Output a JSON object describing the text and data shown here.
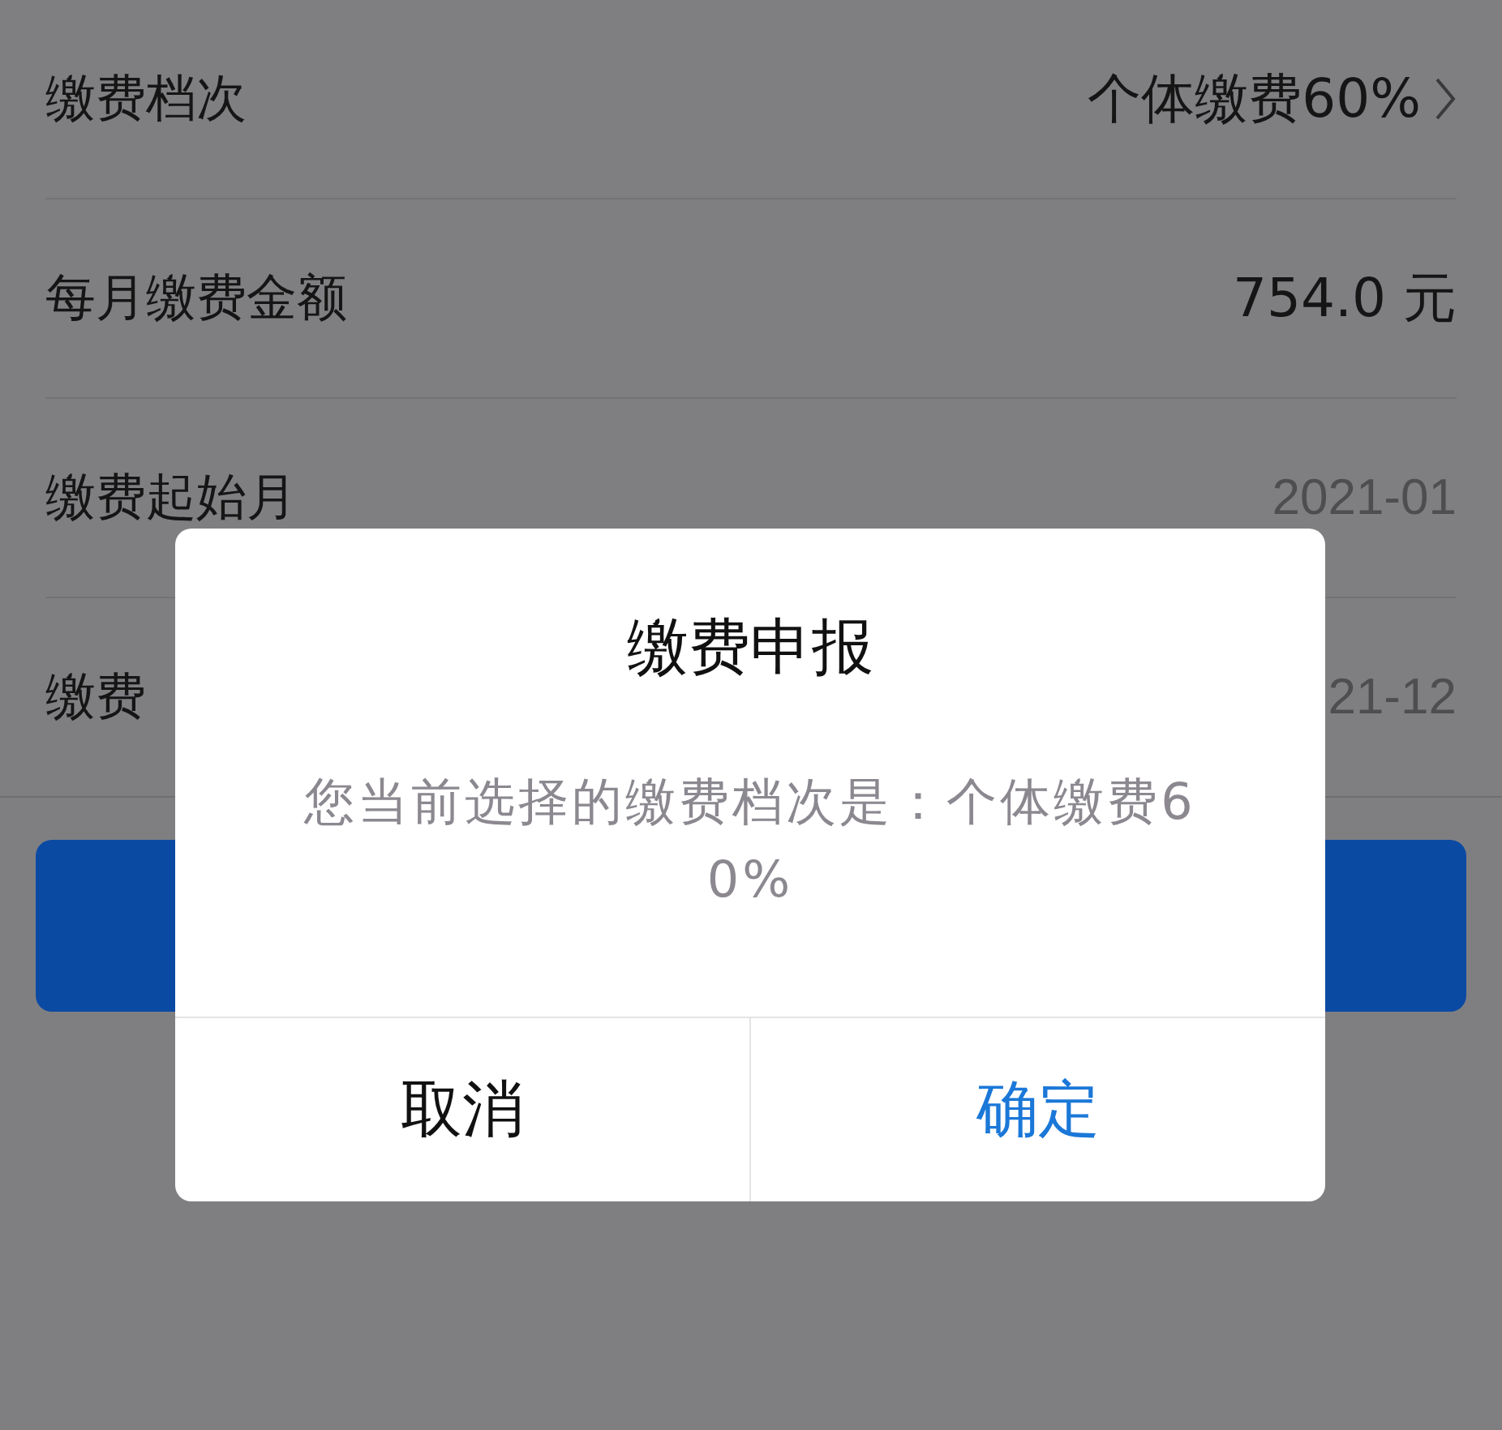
{
  "rows": [
    {
      "label": "缴费档次",
      "value": "个体缴费60%",
      "kind": "link"
    },
    {
      "label": "每月缴费金额",
      "value": "754.0 元",
      "kind": "strong"
    },
    {
      "label": "缴费起始月",
      "value": "2021-01",
      "kind": "muted"
    },
    {
      "label": "缴费",
      "value": "21-12",
      "kind": "muted"
    }
  ],
  "dialog": {
    "title": "缴费申报",
    "message": "您当前选择的缴费档次是：个体缴费60%",
    "buttons": [
      {
        "label": "取消",
        "kind": "cancel"
      },
      {
        "label": "确定",
        "kind": "confirm"
      }
    ]
  }
}
